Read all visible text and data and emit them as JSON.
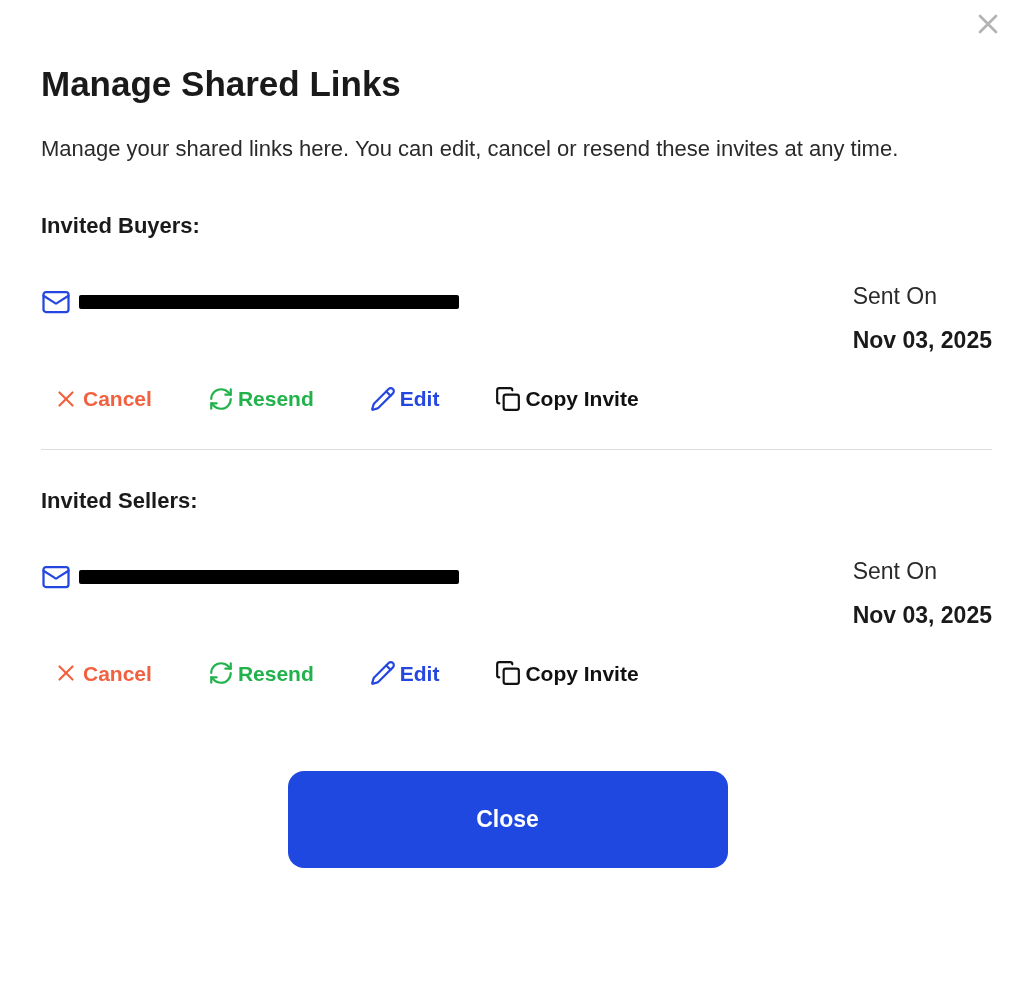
{
  "dialog": {
    "title": "Manage Shared Links",
    "description": "Manage your shared links here. You can edit, cancel or resend these invites at any time."
  },
  "sections": [
    {
      "heading": "Invited Buyers:",
      "invites": [
        {
          "email": {
            "redacted": true
          },
          "sent_label": "Sent On",
          "sent_date": "Nov 03, 2025",
          "actions": [
            {
              "kind": "cancel",
              "label": "Cancel"
            },
            {
              "kind": "resend",
              "label": "Resend"
            },
            {
              "kind": "edit",
              "label": "Edit"
            },
            {
              "kind": "copy",
              "label": "Copy Invite"
            }
          ]
        }
      ]
    },
    {
      "heading": "Invited Sellers:",
      "invites": [
        {
          "email": {
            "redacted": true
          },
          "sent_label": "Sent On",
          "sent_date": "Nov 03, 2025",
          "actions": [
            {
              "kind": "cancel",
              "label": "Cancel"
            },
            {
              "kind": "resend",
              "label": "Resend"
            },
            {
              "kind": "edit",
              "label": "Edit"
            },
            {
              "kind": "copy",
              "label": "Copy Invite"
            }
          ]
        }
      ]
    }
  ],
  "footer": {
    "button": "Close"
  }
}
